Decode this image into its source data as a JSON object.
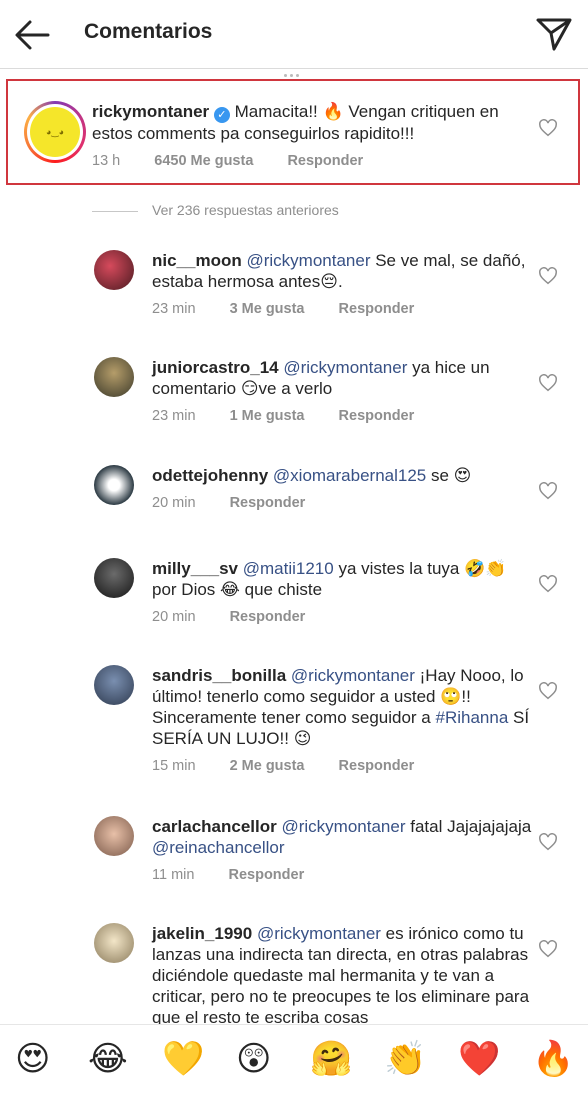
{
  "header": {
    "title": "Comentarios"
  },
  "caption": {
    "user": "rickymontaner",
    "text": "Mamacita!! 🔥 Vengan critiquen en estos comments pa conseguirlos rapidito!!!",
    "time": "13 h",
    "likes": "6450 Me gusta",
    "reply": "Responder"
  },
  "view_previous": "Ver 236 respuestas anteriores",
  "comments": [
    {
      "user": "nic__moon",
      "mention": "@rickymontaner",
      "text": " Se ve mal, se dañó, estaba hermosa antes😔.",
      "time": "23 min",
      "likes": "3 Me gusta",
      "reply": "Responder"
    },
    {
      "user": "juniorcastro_14",
      "mention": "@rickymontaner",
      "text": " ya hice un comentario 😏ve a verlo",
      "time": "23 min",
      "likes": "1 Me gusta",
      "reply": "Responder"
    },
    {
      "user": "odettejohenny",
      "mention": "@xiomarabernal125",
      "text": " se 😍",
      "time": "20 min",
      "likes": "",
      "reply": "Responder"
    },
    {
      "user": "milly___sv",
      "mention": "@matii1210",
      "text": " ya vistes la tuya 🤣👏 por Dios 😂 que chiste",
      "time": "20 min",
      "likes": "",
      "reply": "Responder"
    },
    {
      "user": "sandris__bonilla",
      "mention": "@rickymontaner",
      "text": " ¡Hay Nooo, lo último! tenerlo como seguidor a usted 🙄!! Sinceramente tener como seguidor a ",
      "tag": "#Rihanna",
      "text2": " SÍ SERÍA UN LUJO!! 😉",
      "time": "15 min",
      "likes": "2 Me gusta",
      "reply": "Responder"
    },
    {
      "user": "carlachancellor",
      "mention": "@rickymontaner",
      "text": " fatal Jajajajajaja ",
      "mention2": "@reinachancellor",
      "time": "11 min",
      "likes": "",
      "reply": "Responder"
    },
    {
      "user": "jakelin_1990",
      "mention": "@rickymontaner",
      "text": " es irónico como tu lanzas una indirecta tan directa, en otras palabras diciéndole quedaste mal hermanita y te van a criticar, pero no te preocupes te los eliminare para que el resto te escriba cosas"
    }
  ],
  "quick_emojis": [
    "😍",
    "😂",
    "💛",
    "😲",
    "🤗",
    "👏",
    "❤️",
    "🔥"
  ],
  "colors": {
    "accent_border": "#d0363e",
    "mention": "#385185",
    "meta": "#8e8e8e"
  }
}
